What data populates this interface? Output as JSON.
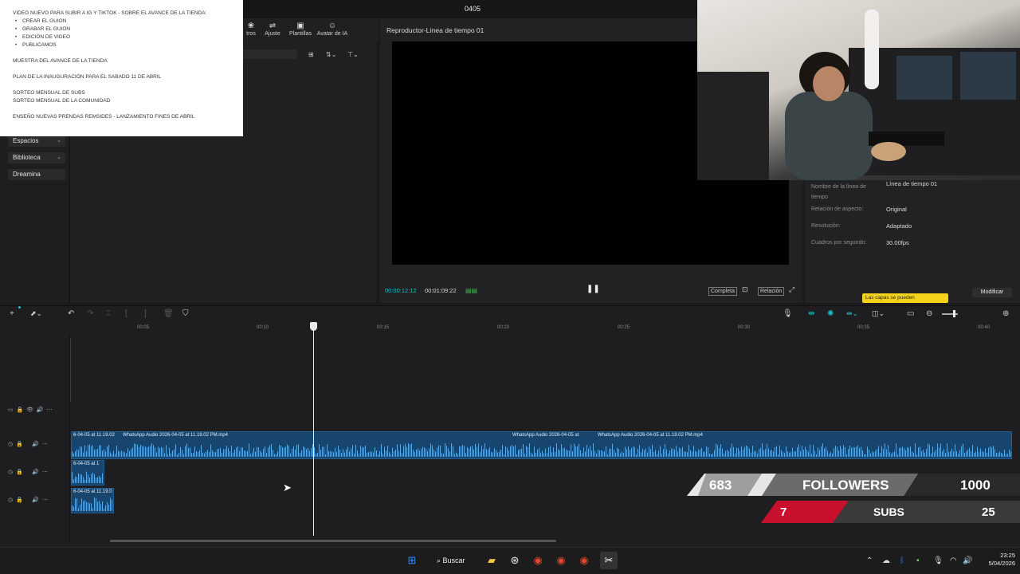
{
  "window": {
    "title": "0405"
  },
  "toolbar": {
    "tools": [
      {
        "label": "tros",
        "icon": "filter-icon"
      },
      {
        "label": "Ajuste",
        "icon": "adjust-icon"
      },
      {
        "label": "Plantillas",
        "icon": "template-icon"
      },
      {
        "label": "Avatar de IA",
        "icon": "ai-avatar-icon"
      }
    ]
  },
  "sidebar": {
    "items": [
      {
        "label": "Espacios",
        "chevron": "⌄"
      },
      {
        "label": "Biblioteca",
        "chevron": "⌄"
      },
      {
        "label": "Dreamina",
        "chevron": ""
      }
    ]
  },
  "notes": {
    "heading": "VIDEO NUEVO PARA SUBIR A IG Y TIKTOK - SOBRE EL AVANCE DE LA TIENDA:",
    "bullets": [
      "CREAR EL GUION",
      "GRABAR EL GUION",
      "EDICIÓN DE VIDEO",
      "PUBLICAMOS"
    ],
    "line1": "MUESTRA DEL AVANCE DE LA TIENDA",
    "line2": "PLAN DE LA INAUGURACIÓN PARA EL SABADO 11 DE ABRIL",
    "line3": "SORTEO MENSUAL DE SUBS",
    "line4": "SORTEO MENSUAL DE LA COMUNIDAD",
    "line5": "ENSEÑO NUEVAS PRENDAS REMSIDES - LANZAMIENTO FINES DE ABRIL"
  },
  "player": {
    "title": "Reproductor-Línea de tiempo 01",
    "current_time": "00:00:12:12",
    "total_time": "00:01:09:22",
    "complete_label": "Completa",
    "ratio_label": "Relación"
  },
  "properties": {
    "name_label": "Nombre de la línea de tiempo",
    "name_value": "Línea de tiempo 01",
    "aspect_label": "Relación de aspecto:",
    "aspect_value": "Original",
    "resolution_label": "Resolución:",
    "resolution_value": "Adaptado",
    "fps_label": "Cuadros por segundo:",
    "fps_value": "30.00fps",
    "tooltip": "Las capas se pueden",
    "modify_label": "Modificar"
  },
  "timeline": {
    "ruler": [
      "00:05",
      "00:10",
      "00:15",
      "00:20",
      "00:25",
      "00:30",
      "00:35",
      "00:40"
    ],
    "clips": {
      "main_a": "6-04-05 at 11.19.02",
      "main_b": "WhatsApp Audio 2026-04-05 at 11.19.02 PM.mp4",
      "main_c": "WhatsApp Audio 2026-04-05 at",
      "main_d": "WhatsApp Audio 2026-04-05 at 11.19.02 PM.mp4",
      "small_1": "6-04-05 at 1",
      "small_2": "6-04-05 at 11.19.0"
    }
  },
  "overlay": {
    "followers_current": "683",
    "followers_label": "FOLLOWERS",
    "followers_goal": "1000",
    "subs_current": "7",
    "subs_label": "SUBS",
    "subs_goal": "25"
  },
  "taskbar": {
    "search_label": "Buscar",
    "time": "23:25",
    "date": "5/04/2026"
  },
  "colors": {
    "accent": "#19c3c9",
    "clip_blue": "#17456e",
    "tooltip_yellow": "#f5d21a",
    "subs_red": "#c8102e"
  }
}
